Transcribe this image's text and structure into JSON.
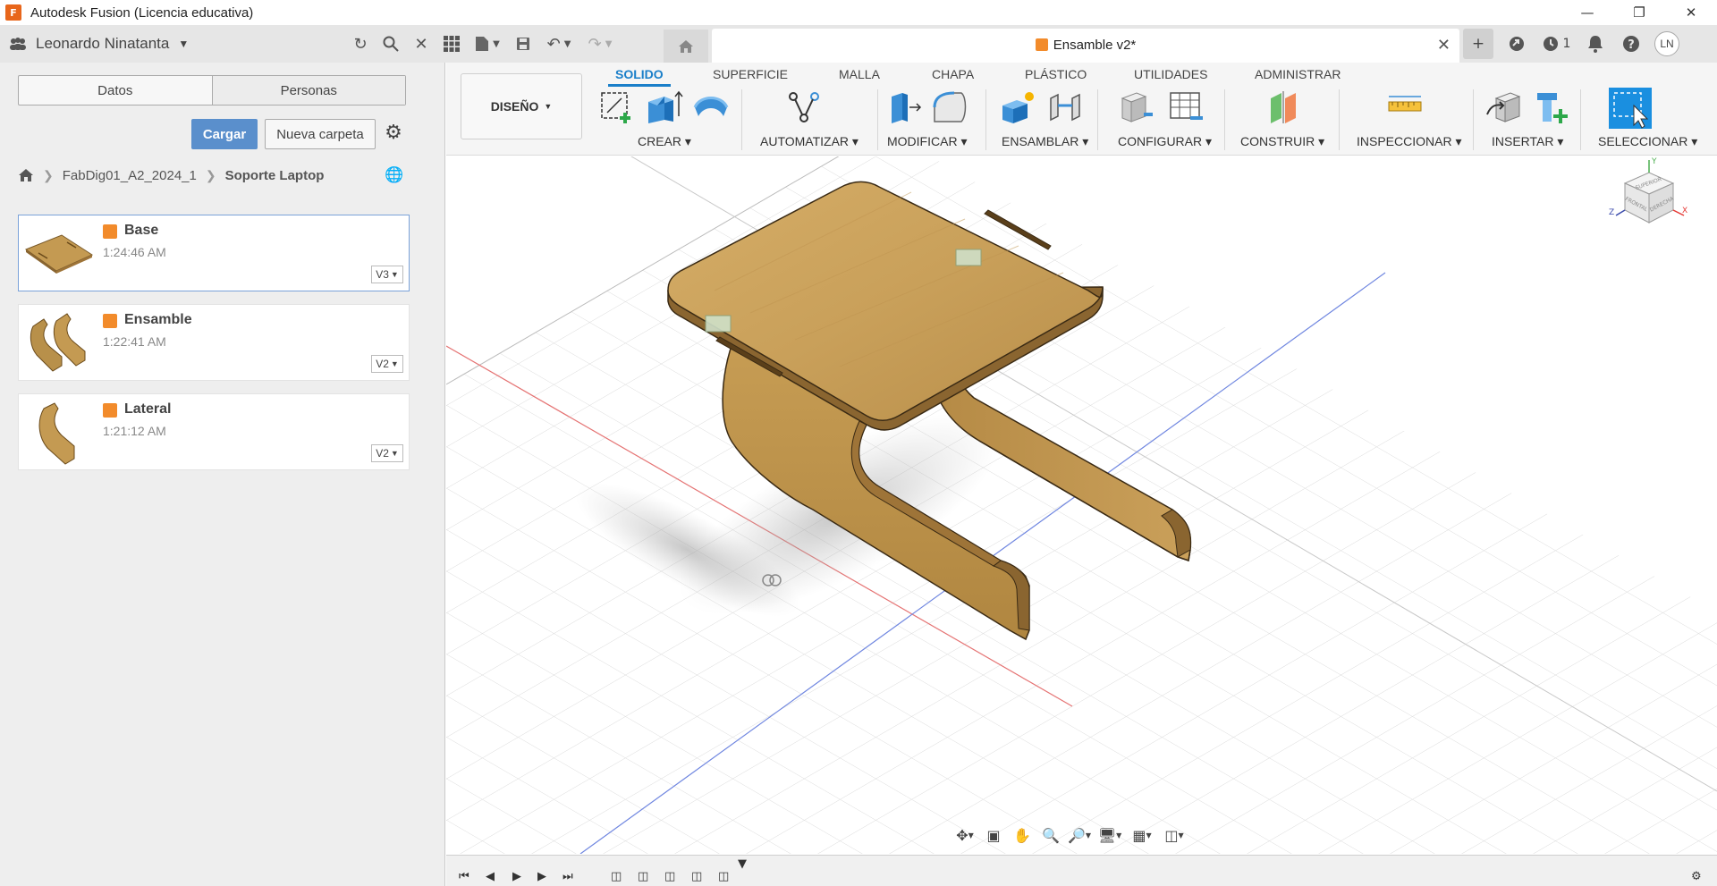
{
  "window": {
    "title": "Autodesk Fusion (Licencia educativa)",
    "app_logo_text": "F",
    "minimize": "—",
    "restore": "❐",
    "close": "✕"
  },
  "topbar": {
    "user_name": "Leonardo Ninatanta",
    "doc_tab_title": "Ensamble v2*",
    "jobs_count": "1",
    "avatar_initials": "LN"
  },
  "data_panel": {
    "tabs": [
      "Datos",
      "Personas"
    ],
    "upload_label": "Cargar",
    "new_folder_label": "Nueva carpeta",
    "breadcrumb": [
      "FabDig01_A2_2024_1",
      "Soporte Laptop"
    ],
    "files": [
      {
        "name": "Base",
        "time": "1:24:46 AM",
        "version": "V3"
      },
      {
        "name": "Ensamble",
        "time": "1:22:41 AM",
        "version": "V2"
      },
      {
        "name": "Lateral",
        "time": "1:21:12 AM",
        "version": "V2"
      }
    ]
  },
  "ribbon": {
    "workspace": "DISEÑO",
    "tabs": [
      "SOLIDO",
      "SUPERFICIE",
      "MALLA",
      "CHAPA",
      "PLÁSTICO",
      "UTILIDADES",
      "ADMINISTRAR"
    ],
    "active_tab": "SOLIDO",
    "groups": [
      "CREAR",
      "AUTOMATIZAR",
      "MODIFICAR",
      "ENSAMBLAR",
      "CONFIGURAR",
      "CONSTRUIR",
      "INSPECCIONAR",
      "INSERTAR",
      "SELECCIONAR"
    ]
  },
  "viewcube": {
    "top": "SUPERIOR",
    "front": "FRONTAL",
    "right": "DERECHA",
    "axis_x": "X",
    "axis_y": "Y",
    "axis_z": "Z"
  },
  "colors": {
    "accent": "#1a7fc9",
    "upload_button": "#5a8fcc",
    "wood": "#c49a52",
    "file_icon": "#f28b2b"
  }
}
